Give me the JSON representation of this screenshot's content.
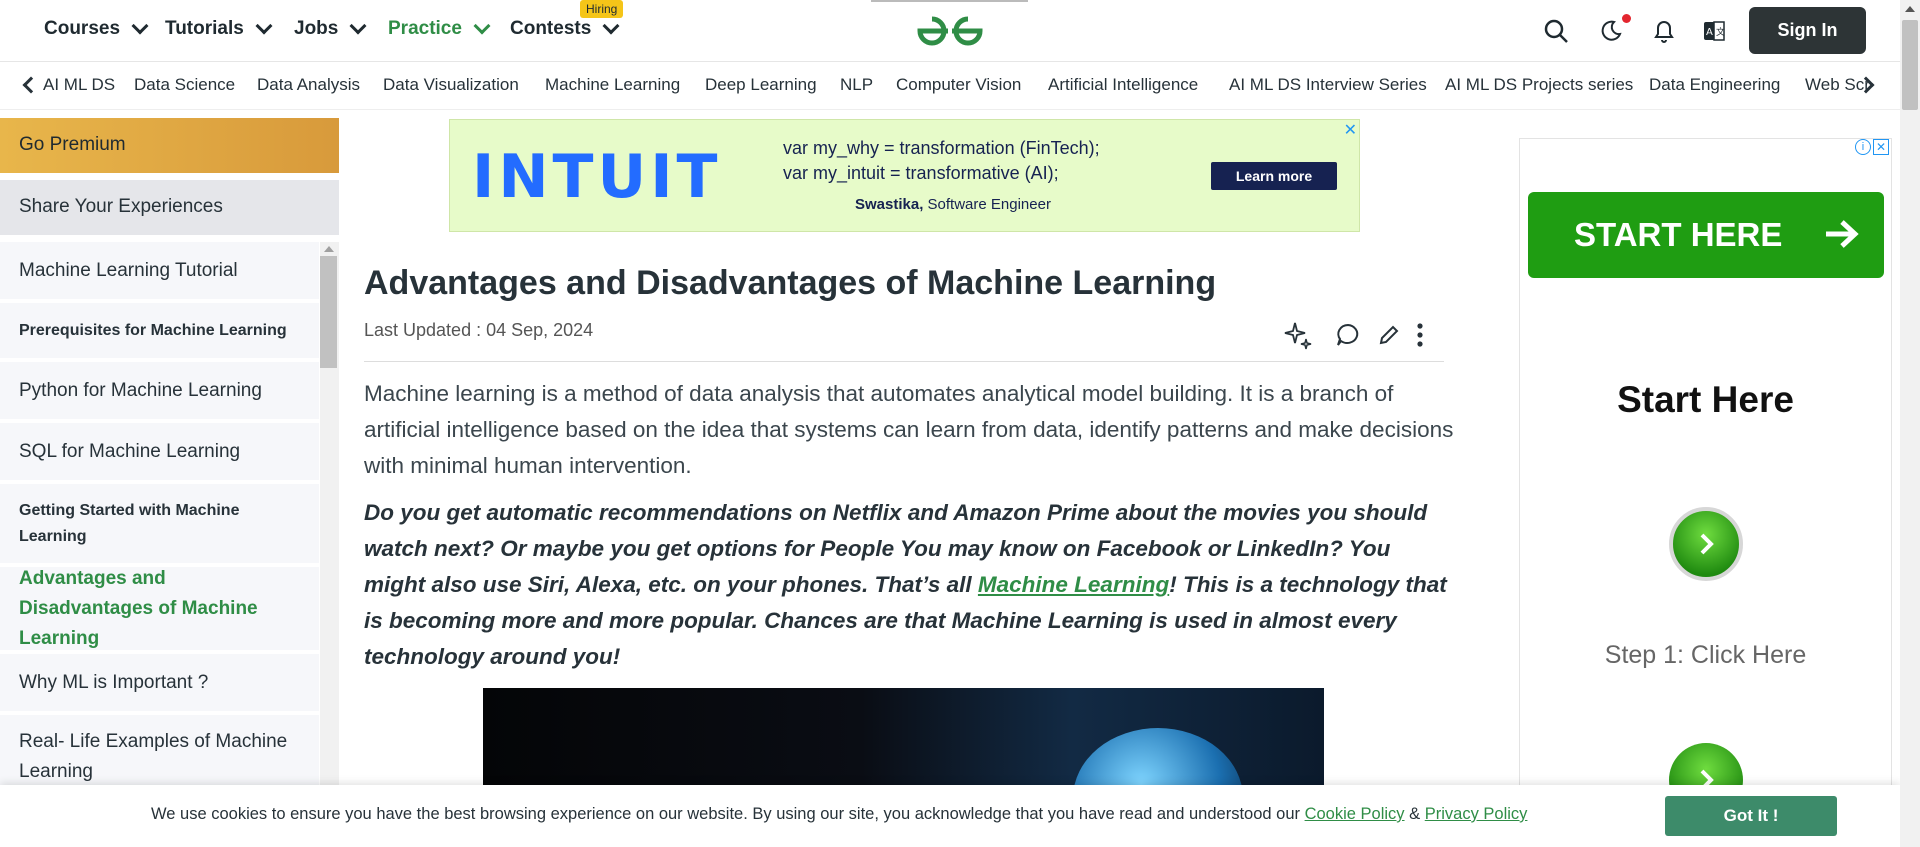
{
  "nav": {
    "items": [
      {
        "label": "Courses"
      },
      {
        "label": "Tutorials"
      },
      {
        "label": "Jobs"
      },
      {
        "label": "Practice"
      },
      {
        "label": "Contests"
      }
    ],
    "hiring_badge": "Hiring",
    "sign_in": "Sign In",
    "accent_green": "#2f8d46"
  },
  "subnav": {
    "items": [
      "AI ML DS",
      "Data Science",
      "Data Analysis",
      "Data Visualization",
      "Machine Learning",
      "Deep Learning",
      "NLP",
      "Computer Vision",
      "Artificial Intelligence",
      "AI ML DS Interview Series",
      "AI ML DS Projects series",
      "Data Engineering",
      "Web Scr"
    ]
  },
  "sidebar": {
    "premium": "Go Premium",
    "share": "Share Your Experiences",
    "items": [
      {
        "label": "Machine Learning Tutorial"
      },
      {
        "label": "Prerequisites for Machine Learning"
      },
      {
        "label": "Python for Machine Learning"
      },
      {
        "label": "SQL for Machine Learning"
      },
      {
        "label": "Getting Started with Machine Learning"
      },
      {
        "label": "Advantages and Disadvantages of Machine Learning"
      },
      {
        "label": "Why ML is Important ?"
      },
      {
        "label": "Real- Life Examples of Machine Learning"
      }
    ]
  },
  "ad_top": {
    "brand": "INTUIT",
    "line1": "var my_why =  transformation (FinTech);",
    "line2": "var my_intuit = transformative (AI);",
    "caption_name": "Swastika,",
    "caption_role": " Software Engineer",
    "cta": "Learn more",
    "close": "✕"
  },
  "article": {
    "title": "Advantages and Disadvantages of Machine Learning",
    "updated": "Last Updated : 04 Sep, 2024",
    "para1": "Machine learning is a method of data analysis that automates analytical model building. It is a branch of artificial intelligence based on the idea that systems can learn from data, identify patterns and make decisions with minimal human intervention.",
    "para2_before": "Do you get automatic recommendations on Netflix and Amazon Prime about the movies you should watch next? Or maybe you get options for People You may know on Facebook or LinkedIn? You might also use Siri, Alexa, etc. on your phones. That’s all ",
    "para2_link": "Machine Learning",
    "para2_after": "! This is a technology that is becoming more and more popular. Chances are that Machine Learning is used in almost every technology around you!"
  },
  "ad_right": {
    "start_button": "START HERE",
    "start_text": "Start Here",
    "step_text": "Step 1: Click Here"
  },
  "cookie": {
    "text": "We use cookies to ensure you have the best browsing experience on our website. By using our site, you acknowledge that you have read and understood our ",
    "cookie_policy": "Cookie Policy",
    "amp": " & ",
    "privacy_policy": "Privacy Policy",
    "button": "Got It !"
  }
}
